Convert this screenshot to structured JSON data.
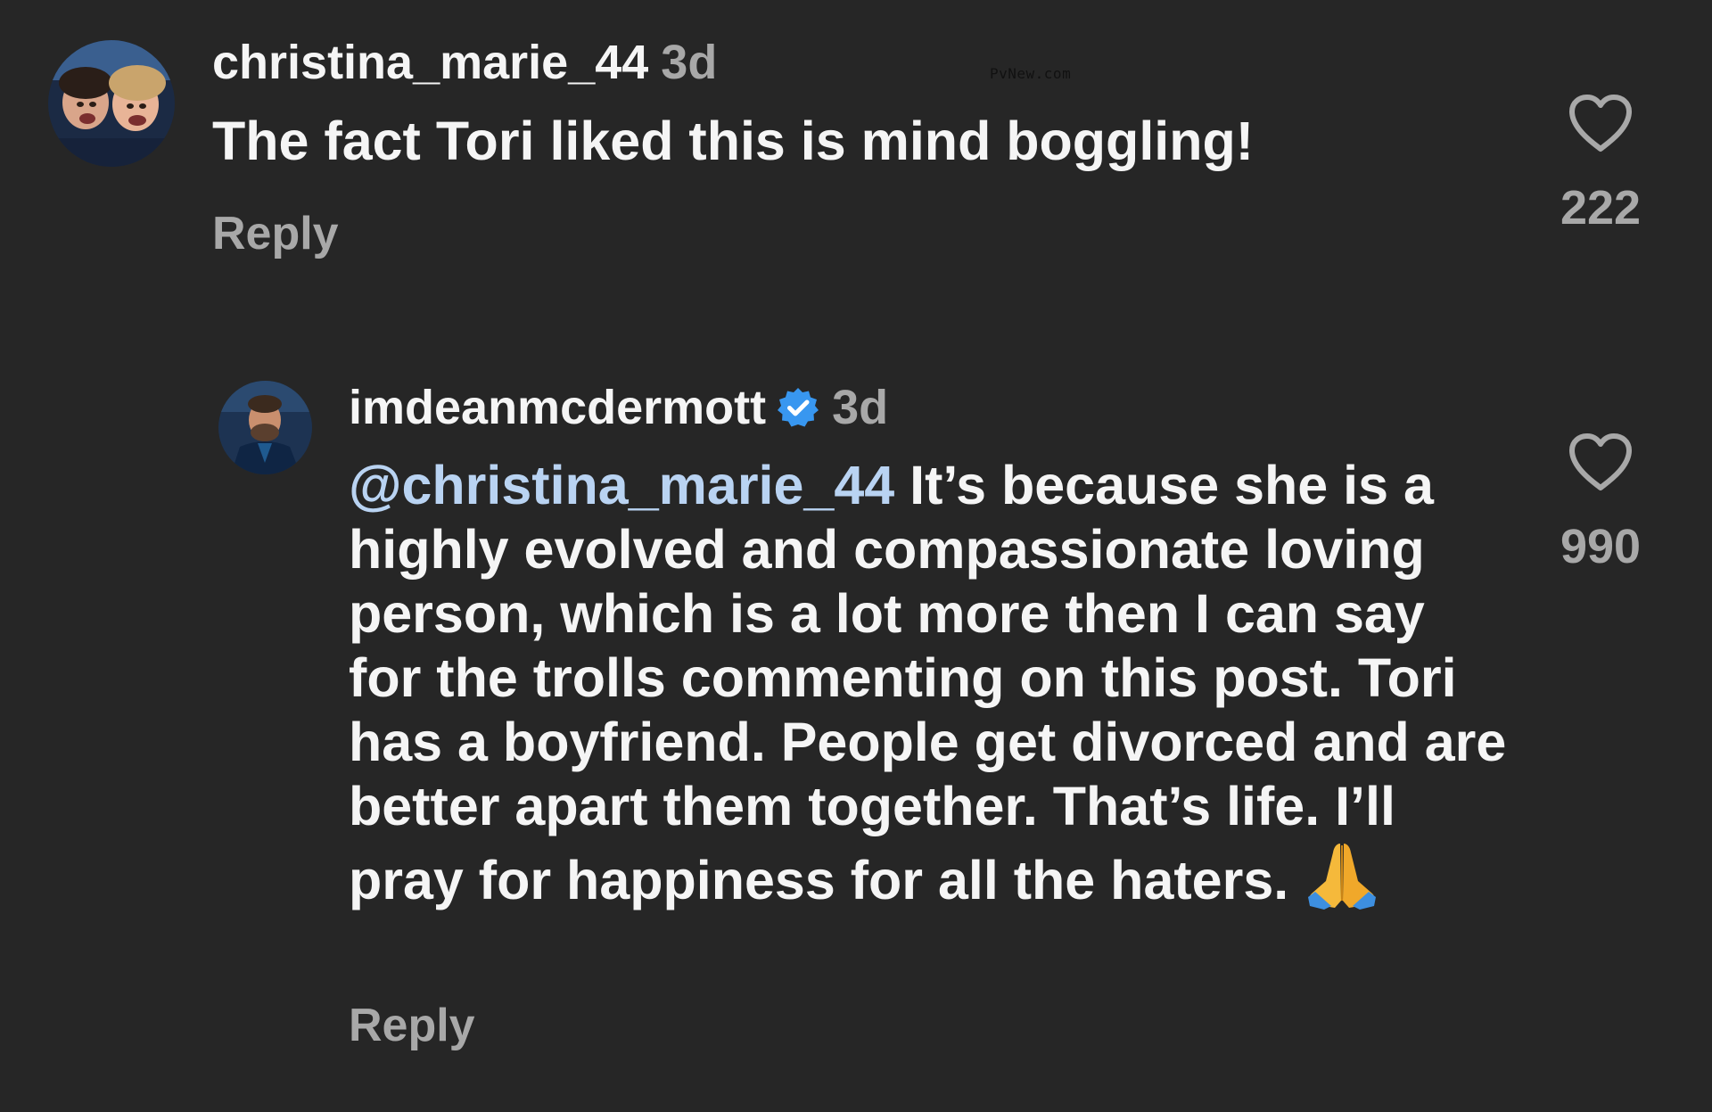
{
  "watermark": "PvNew.com",
  "comments": [
    {
      "username": "christina_marie_44",
      "timestamp": "3d",
      "text": "The fact Tori liked this is mind boggling!",
      "reply_label": "Reply",
      "like_count": "222",
      "like_icon": "heart-outline-icon",
      "avatar": "profile-photo"
    },
    {
      "username": "imdeanmcdermott",
      "verified": true,
      "verified_icon": "verified-badge-icon",
      "timestamp": "3d",
      "mention": "@christina_marie_44",
      "text": " It’s because she is a highly evolved and compassionate loving person, which is a lot more then I can say for the trolls commenting on this post. Tori has a boyfriend. People get divorced and are better apart them together. That’s life. I’ll pray for happiness for all the haters.",
      "emoji": "folded-hands-emoji",
      "reply_label": "Reply",
      "like_count": "990",
      "like_icon": "heart-outline-icon",
      "avatar": "profile-photo"
    }
  ],
  "colors": {
    "background": "#262626",
    "primary_text": "#f5f5f5",
    "secondary_text": "#a8a8a8",
    "mention": "#b9d3f2",
    "verified": "#3897f0"
  }
}
